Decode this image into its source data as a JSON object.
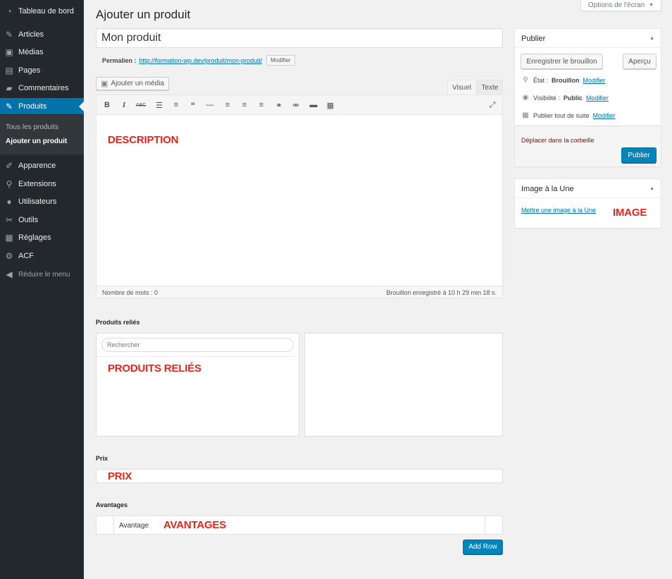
{
  "sidebar": {
    "items": [
      {
        "label": "Tableau de bord",
        "icon": "dashboard-icon"
      },
      {
        "label": "Articles",
        "icon": "pin-icon"
      },
      {
        "label": "Médias",
        "icon": "media-icon"
      },
      {
        "label": "Pages",
        "icon": "pages-icon"
      },
      {
        "label": "Commentaires",
        "icon": "comments-icon"
      },
      {
        "label": "Produits",
        "icon": "pin-icon"
      },
      {
        "label": "Apparence",
        "icon": "appearance-icon"
      },
      {
        "label": "Extensions",
        "icon": "plugins-icon"
      },
      {
        "label": "Utilisateurs",
        "icon": "users-icon"
      },
      {
        "label": "Outils",
        "icon": "tools-icon"
      },
      {
        "label": "Réglages",
        "icon": "settings-icon"
      },
      {
        "label": "ACF",
        "icon": "gear-icon"
      }
    ],
    "submenu": [
      "Tous les produits",
      "Ajouter un produit"
    ],
    "collapse_label": "Réduire le menu",
    "accent": "#0073aa"
  },
  "header": {
    "screen_options": "Options de l'écran",
    "page_title": "Ajouter un produit"
  },
  "post": {
    "title_value": "Mon produit",
    "permalink_label": "Permalien :",
    "permalink_url": "http://formation-wp.dev/produit/mon-produit/",
    "permalink_edit": "Modifier"
  },
  "editor": {
    "add_media": "Ajouter un média",
    "tab_visual": "Visuel",
    "tab_text": "Texte",
    "overlay": "DESCRIPTION",
    "word_count": "Nombre de mots : 0",
    "draft_saved": "Brouillon enregistré à 10 h 29 min 18 s."
  },
  "related": {
    "label": "Produits reliés",
    "search_placeholder": "Rechercher",
    "overlay": "PRODUITS RELIÉS"
  },
  "price": {
    "label": "Prix",
    "overlay": "PRIX"
  },
  "advantages": {
    "label": "Avantages",
    "row_label": "Avantage",
    "overlay": "AVANTAGES",
    "add_row": "Add Row"
  },
  "publish": {
    "title": "Publier",
    "save_draft": "Enregistrer le brouillon",
    "preview": "Aperçu",
    "status_label": "État :",
    "status_value": "Brouillon",
    "visibility_label": "Visibilité :",
    "visibility_value": "Public",
    "schedule_label": "Publier tout de suite",
    "edit_link": "Modifier",
    "trash": "Déplacer dans la corbeille",
    "publish_button": "Publier"
  },
  "featured": {
    "title": "Image à la Une",
    "set_link": "Mettre une image à la Une",
    "overlay": "IMAGE"
  }
}
